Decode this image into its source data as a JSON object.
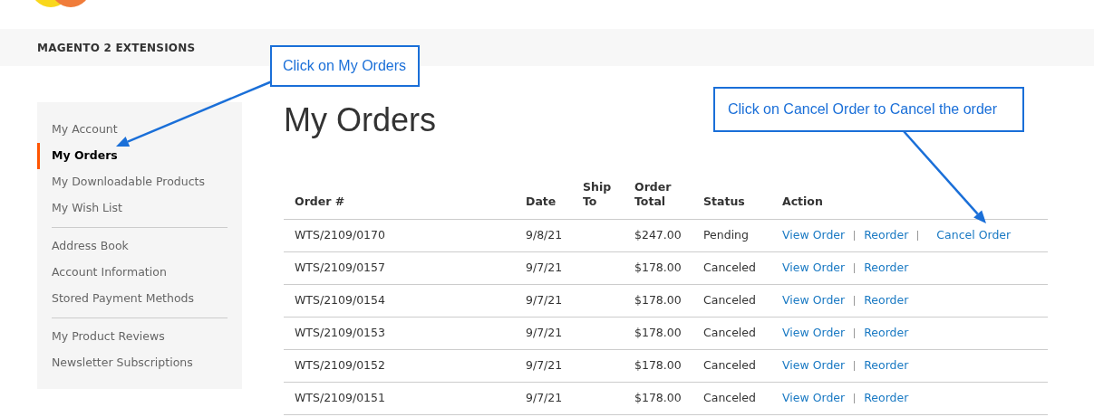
{
  "nav": {
    "title": "MAGENTO 2 EXTENSIONS"
  },
  "sidebar": {
    "groups": [
      {
        "items": [
          {
            "label": "My Account",
            "selected": false
          },
          {
            "label": "My Orders",
            "selected": true
          },
          {
            "label": "My Downloadable Products",
            "selected": false
          },
          {
            "label": "My Wish List",
            "selected": false
          }
        ]
      },
      {
        "items": [
          {
            "label": "Address Book",
            "selected": false
          },
          {
            "label": "Account Information",
            "selected": false
          },
          {
            "label": "Stored Payment Methods",
            "selected": false
          }
        ]
      },
      {
        "items": [
          {
            "label": "My Product Reviews",
            "selected": false
          },
          {
            "label": "Newsletter Subscriptions",
            "selected": false
          }
        ]
      }
    ]
  },
  "page_title": "My Orders",
  "table": {
    "columns": [
      "Order #",
      "Date",
      "Ship To",
      "Order Total",
      "Status",
      "Action"
    ],
    "rows": [
      {
        "cells": [
          "WTS/2109/0170",
          "9/8/21",
          "",
          "$247.00",
          "Pending"
        ],
        "actions": [
          "View Order",
          "Reorder",
          "Cancel Order"
        ]
      },
      {
        "cells": [
          "WTS/2109/0157",
          "9/7/21",
          "",
          "$178.00",
          "Canceled"
        ],
        "actions": [
          "View Order",
          "Reorder"
        ]
      },
      {
        "cells": [
          "WTS/2109/0154",
          "9/7/21",
          "",
          "$178.00",
          "Canceled"
        ],
        "actions": [
          "View Order",
          "Reorder"
        ]
      },
      {
        "cells": [
          "WTS/2109/0153",
          "9/7/21",
          "",
          "$178.00",
          "Canceled"
        ],
        "actions": [
          "View Order",
          "Reorder"
        ]
      },
      {
        "cells": [
          "WTS/2109/0152",
          "9/7/21",
          "",
          "$178.00",
          "Canceled"
        ],
        "actions": [
          "View Order",
          "Reorder"
        ]
      },
      {
        "cells": [
          "WTS/2109/0151",
          "9/7/21",
          "",
          "$178.00",
          "Canceled"
        ],
        "actions": [
          "View Order",
          "Reorder"
        ]
      }
    ]
  },
  "callouts": [
    "Click on My Orders",
    "Click on Cancel Order to Cancel the order"
  ]
}
